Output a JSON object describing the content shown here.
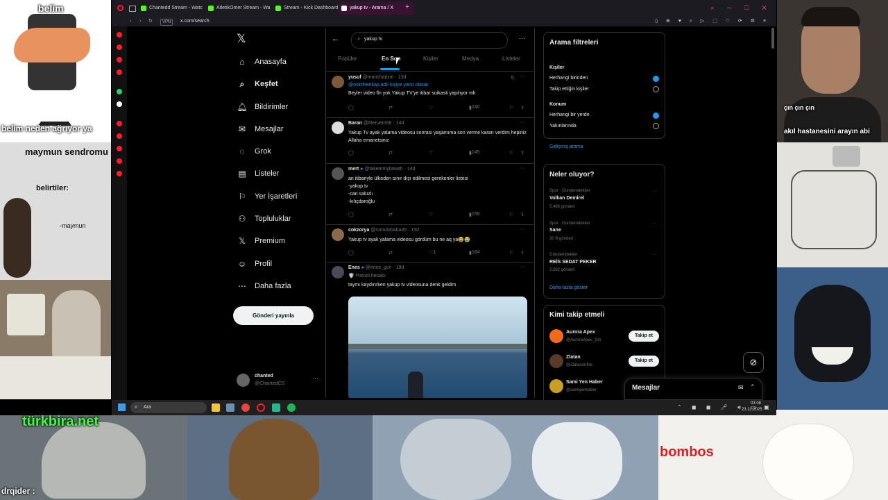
{
  "overlays": {
    "top_left_caption": "belim",
    "top_left_caption2": "belim neden ağrıyor ya",
    "mid_left_title": "maymun sendromu",
    "mid_left_sub": "belirtiler:",
    "mid_left_sub2": "-maymun",
    "top_right_caption1": "çın çın çın",
    "top_right_caption2": "akıl hastanesini arayın abi",
    "bottom_caption_turkbira": "türkbira.net",
    "bottom_caption_bombos": "bombos",
    "chat_name": "drqider :"
  },
  "browser": {
    "tabs": [
      {
        "label": "Chantedd Stream - Watc",
        "color": "#53fc18"
      },
      {
        "label": "AtletikOmer Stream - Wa",
        "color": "#53fc18"
      },
      {
        "label": "Stream - Kick Dashboard",
        "color": "#53fc18"
      },
      {
        "label": "yakup tv - Arama / X",
        "color": "#ffffff"
      }
    ],
    "new_tab": "+",
    "vpn": "VPN",
    "url": "x.com/search"
  },
  "nav": {
    "logo": "𝕏",
    "items": [
      {
        "label": "Anasayfa",
        "icon": "⌂"
      },
      {
        "label": "Keşfet",
        "icon": "⌕"
      },
      {
        "label": "Bildirimler",
        "icon": "🔔︎"
      },
      {
        "label": "Mesajlar",
        "icon": "✉"
      },
      {
        "label": "Grok",
        "icon": "◌"
      },
      {
        "label": "Listeler",
        "icon": "▤"
      },
      {
        "label": "Yer İşaretleri",
        "icon": "⚐"
      },
      {
        "label": "Topluluklar",
        "icon": "⚇"
      },
      {
        "label": "Premium",
        "icon": "𝕏"
      },
      {
        "label": "Profil",
        "icon": "☺"
      },
      {
        "label": "Daha fazla",
        "icon": "⋯"
      }
    ],
    "post_button": "Gönderi yayınla",
    "account_name": "chanted",
    "account_handle": "@ChantedCS",
    "account_more": "···"
  },
  "search": {
    "query": "yakup tv",
    "more": "···",
    "back": "←",
    "tabs": [
      "Popüler",
      "En Son",
      "Kişiler",
      "Medya",
      "Listeler"
    ]
  },
  "tweets": [
    {
      "name": "yusuf",
      "handle": "@marichatizm · 13d",
      "reply_to": "@osimhenkap adlı kişiye yanıt olarak",
      "text": "Beyler video fln yok Yakup TV'ye itibar suikasti yapılıyor mk",
      "views": "240",
      "likes": ""
    },
    {
      "name": "Baran",
      "handle": "@Meruem58 · 14d",
      "reply_to": "",
      "text": "Yakup Tv ayak yalama videosu sonrası yaşamıma son verme kararı verdim hepiniz Allaha emanetsiniz",
      "views": "145",
      "likes": ""
    },
    {
      "name": "mert",
      "handle": "@takemmybreath · 14d",
      "reply_to": "",
      "text": "an itibariyle ülkeden sınır dışı edilmesi gerekenler listesi\n-yakup tv\n-can sakızlı\n-kılıçdaroğlu",
      "views": "156",
      "likes": ""
    },
    {
      "name": "cokzorya",
      "handle": "@romulobaba35 · 15d",
      "reply_to": "",
      "text": "Yakup tv ayak yalama videosu gördüm bu ne aq ya😂😭",
      "views": "184",
      "likes": "1"
    },
    {
      "name": "Enes",
      "handle": "@enes_gcn · 19d",
      "reply_to": "🛡️ Parodi hesabı",
      "text": "taymı kaydırırken yakup tv videosuna denk geldim",
      "views": "",
      "likes": ""
    }
  ],
  "filters": {
    "title": "Arama filtreleri",
    "people_label": "Kişiler",
    "people_opt1": "Herhangi birinden",
    "people_opt2": "Takip ettiğin kişiler",
    "location_label": "Konum",
    "loc_opt1": "Herhangi bir yerde",
    "loc_opt2": "Yakınlarında",
    "advanced": "Gelişmiş arama"
  },
  "trends": {
    "title": "Neler oluyor?",
    "items": [
      {
        "meta": "Spor · Gündemdekiler",
        "name": "Volkan Demirel",
        "count": "5.486 gönderi"
      },
      {
        "meta": "Spor · Gündemdekiler",
        "name": "Sane",
        "count": "30 B gönderi"
      },
      {
        "meta": "Gündemdekiler",
        "name": "REİS SEDAT PEKER",
        "count": "2.592 gönderi"
      }
    ],
    "more": "Daha fazla göster",
    "dots": "···"
  },
  "who_to_follow": {
    "title": "Kimi takip etmeli",
    "items": [
      {
        "name": "Aurora Apex",
        "handle": "@AuroraApex_GG",
        "button": "Takip et"
      },
      {
        "name": "Zlatan",
        "handle": "@Zlatanonfire",
        "button": "Takip et"
      },
      {
        "name": "Sami Yen Haber",
        "handle": "@samiyenhaber",
        "button": ""
      }
    ]
  },
  "messages_bar": {
    "label": "Mesajlar"
  },
  "taskbar": {
    "search": "Ara",
    "time": "03:08",
    "date": "23.11.2025"
  },
  "colors": {
    "accent": "#1d9bf0",
    "kick": "#53fc18",
    "opera": "#ff1b2d"
  }
}
